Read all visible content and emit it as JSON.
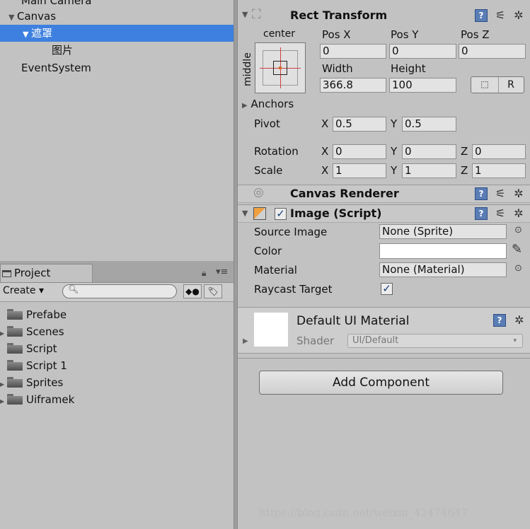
{
  "hierarchy": {
    "items": [
      {
        "label": "Main Camera",
        "indent": 1,
        "expander": ""
      },
      {
        "label": "Canvas",
        "indent": 0,
        "expander": "▼"
      },
      {
        "label": "遮罩",
        "indent": 1,
        "expander": "▼",
        "selected": true
      },
      {
        "label": "图片",
        "indent": 2,
        "expander": ""
      },
      {
        "label": "EventSystem",
        "indent": 1,
        "expander": ""
      }
    ]
  },
  "project": {
    "tab_label": "Project",
    "create_label": "Create ▾",
    "search_placeholder": "",
    "folders": [
      {
        "label": "Prefabe",
        "has_children": false
      },
      {
        "label": "Scenes",
        "has_children": true
      },
      {
        "label": "Script",
        "has_children": false
      },
      {
        "label": "Script 1",
        "has_children": false
      },
      {
        "label": "Sprites",
        "has_children": true
      },
      {
        "label": "Uiframek",
        "has_children": true
      }
    ]
  },
  "inspector": {
    "rect_transform": {
      "title": "Rect Transform",
      "anchor_h": "center",
      "anchor_v": "middle",
      "pos_x_label": "Pos X",
      "pos_y_label": "Pos Y",
      "pos_z_label": "Pos Z",
      "pos_x": "0",
      "pos_y": "0",
      "pos_z": "0",
      "width_label": "Width",
      "height_label": "Height",
      "width": "366.8",
      "height": "100",
      "r_button": "R",
      "anchors_label": "Anchors",
      "pivot_label": "Pivot",
      "pivot_x": "0.5",
      "pivot_y": "0.5",
      "rotation_label": "Rotation",
      "rot_x": "0",
      "rot_y": "0",
      "rot_z": "0",
      "scale_label": "Scale",
      "scale_x": "1",
      "scale_y": "1",
      "scale_z": "1",
      "x_label": "X",
      "y_label": "Y",
      "z_label": "Z"
    },
    "canvas_renderer": {
      "title": "Canvas Renderer"
    },
    "image": {
      "title": "Image (Script)",
      "enabled": true,
      "source_image_label": "Source Image",
      "source_image": "None (Sprite)",
      "color_label": "Color",
      "color_value": "#ffffff",
      "material_label": "Material",
      "material": "None (Material)",
      "raycast_label": "Raycast Target",
      "raycast": true
    },
    "material_preview": {
      "title": "Default UI Material",
      "shader_label": "Shader",
      "shader": "UI/Default"
    },
    "add_component": "Add Component"
  },
  "watermark": "https://blog.csdn.net/weixin_42474647",
  "colors": {
    "selection": "#3d80df",
    "panel": "#c2c2c2"
  }
}
